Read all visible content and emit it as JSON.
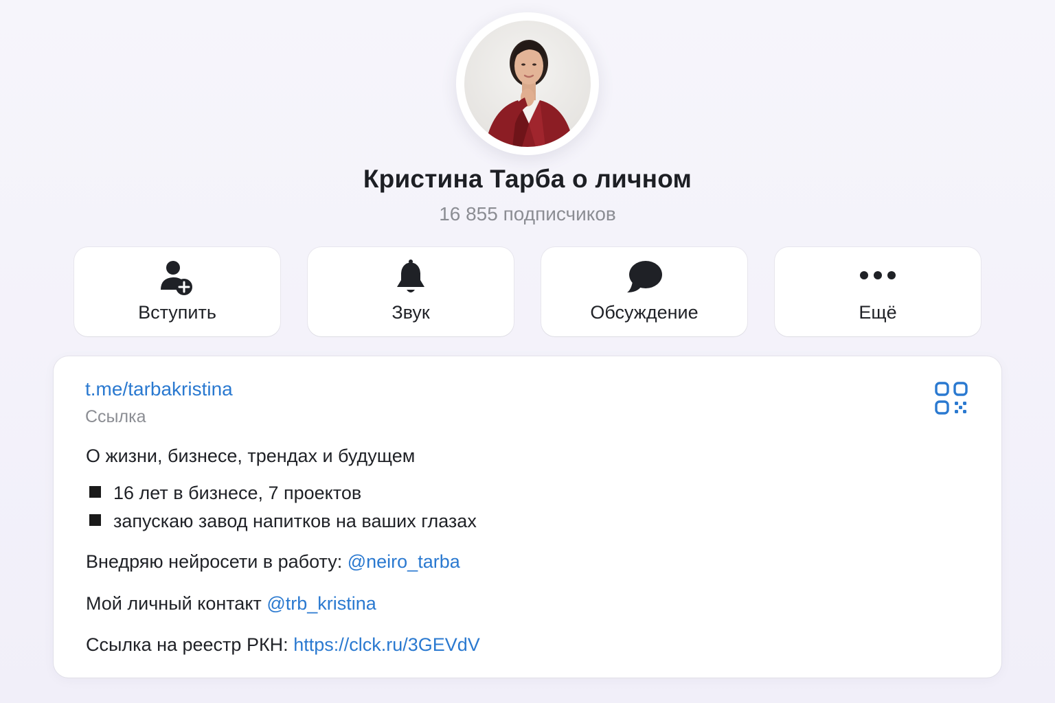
{
  "profile": {
    "name": "Кристина Тарба о личном",
    "subscribers": "16 855 подписчиков"
  },
  "actions": [
    {
      "label": "Вступить",
      "icon": "add-user-icon"
    },
    {
      "label": "Звук",
      "icon": "bell-icon"
    },
    {
      "label": "Обсуждение",
      "icon": "chat-bubble-icon"
    },
    {
      "label": "Ещё",
      "icon": "more-dots-icon"
    }
  ],
  "info": {
    "link": "t.me/tarbakristina",
    "link_caption": "Ссылка",
    "qr_icon": "qr-code-icon",
    "description_title": "О жизни, бизнесе, трендах и будущем",
    "bullets": [
      "16 лет в бизнесе, 7 проектов",
      "запускаю завод напитков на ваших глазах"
    ],
    "neiro_prefix": "Внедряю нейросети в работу: ",
    "neiro_handle": "@neiro_tarba",
    "contact_prefix": "Мой личный контакт ",
    "contact_handle": "@trb_kristina",
    "rkn_prefix": "Ссылка на реестр РКН: ",
    "rkn_link": "https://clck.ru/3GEVdV"
  },
  "colors": {
    "accent": "#2a79d0",
    "muted": "#8b8d93",
    "background": "#f4f3fa"
  }
}
